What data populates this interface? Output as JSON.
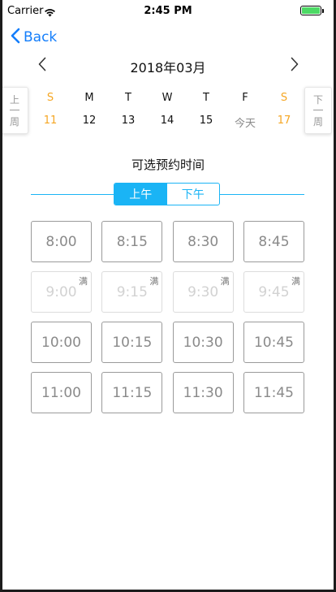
{
  "status_bar": {
    "carrier": "Carrier",
    "time": "2:45 PM",
    "battery_color": "#4cd964",
    "icons": [
      "wifi-icon",
      "battery-icon"
    ]
  },
  "nav": {
    "back_label": "Back",
    "back_icon": "chevron-left-icon"
  },
  "calendar": {
    "month_title": "2018年03月",
    "prev_icon": "chevron-left-icon",
    "next_icon": "chevron-right-icon",
    "prev_week": {
      "top": "上",
      "bottom": "周"
    },
    "next_week": {
      "top": "下",
      "bottom": "周"
    },
    "days": [
      {
        "letter": "S",
        "date": "11",
        "weekend": true
      },
      {
        "letter": "M",
        "date": "12",
        "weekend": false
      },
      {
        "letter": "T",
        "date": "13",
        "weekend": false
      },
      {
        "letter": "W",
        "date": "14",
        "weekend": false
      },
      {
        "letter": "T",
        "date": "15",
        "weekend": false
      },
      {
        "letter": "F",
        "date": "今天",
        "weekend": false,
        "today": true
      },
      {
        "letter": "S",
        "date": "17",
        "weekend": true
      }
    ],
    "weekend_color": "#f5a623"
  },
  "booking": {
    "title": "可选预约时间",
    "accent_color": "#1ab4f5",
    "tabs": [
      {
        "label": "上午",
        "active": true
      },
      {
        "label": "下午",
        "active": false
      }
    ],
    "full_label": "满",
    "slots": [
      [
        {
          "time": "8:00",
          "full": false
        },
        {
          "time": "8:15",
          "full": false
        },
        {
          "time": "8:30",
          "full": false
        },
        {
          "time": "8:45",
          "full": false
        }
      ],
      [
        {
          "time": "9:00",
          "full": true
        },
        {
          "time": "9:15",
          "full": true
        },
        {
          "time": "9:30",
          "full": true
        },
        {
          "time": "9:45",
          "full": true
        }
      ],
      [
        {
          "time": "10:00",
          "full": false
        },
        {
          "time": "10:15",
          "full": false
        },
        {
          "time": "10:30",
          "full": false
        },
        {
          "time": "10:45",
          "full": false
        }
      ],
      [
        {
          "time": "11:00",
          "full": false
        },
        {
          "time": "11:15",
          "full": false
        },
        {
          "time": "11:30",
          "full": false
        },
        {
          "time": "11:45",
          "full": false
        }
      ]
    ]
  }
}
